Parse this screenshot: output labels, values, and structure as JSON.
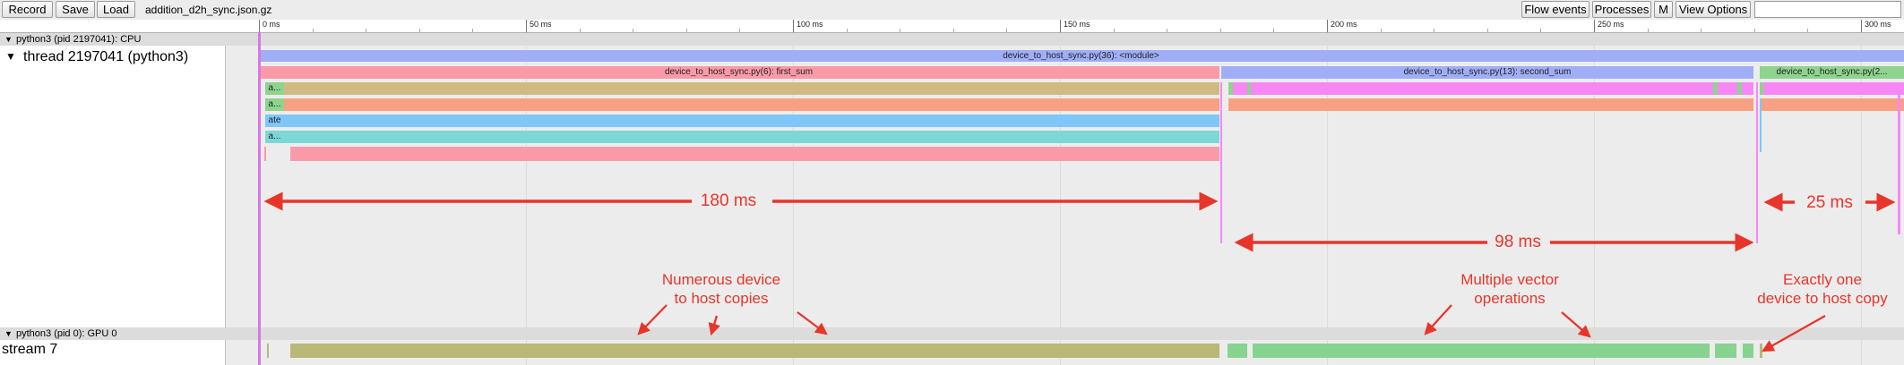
{
  "toolbar": {
    "record_label": "Record",
    "save_label": "Save",
    "load_label": "Load",
    "filename": "addition_d2h_sync.json.gz",
    "flow_events_label": "Flow events",
    "processes_label": "Processes",
    "m_label": "M",
    "view_options_label": "View Options",
    "search_value": ""
  },
  "ruler": {
    "ticks": [
      "0 ms",
      "50 ms",
      "100 ms",
      "150 ms",
      "200 ms",
      "250 ms",
      "300 ms"
    ]
  },
  "cpu_process": {
    "title": "python3 (pid 2197041): CPU",
    "thread_name": "thread 2197041 (python3)"
  },
  "gpu_process": {
    "title": "python3 (pid 0): GPU 0",
    "stream_name": "stream 7"
  },
  "slices": {
    "module": "device_to_host_sync.py(36): <module>",
    "first_sum": "device_to_host_sync.py(6): first_sum",
    "second_sum": "device_to_host_sync.py(13): second_sum",
    "third": "device_to_host_sync.py(2...",
    "stack": [
      "a...",
      "a...",
      "ate",
      "a..."
    ]
  },
  "annotations": {
    "d1": "180 ms",
    "d2": "98 ms",
    "d3": "25 ms",
    "note1": "Numerous device\nto host copies",
    "note2": "Multiple vector\noperations",
    "note3": "Exactly one\ndevice to host copy"
  },
  "colors": {
    "module": "#9faef7",
    "first_sum": "#fa9aa8",
    "olive": "#cfbb82",
    "salmon": "#f7a182",
    "skyblue": "#7fc7f8",
    "teal": "#7dd7d6",
    "magenta": "#f887f6",
    "green": "#8ed38e",
    "gpu_olive": "#b9b877",
    "gpu_green": "#86d48f",
    "annotation": "#e8352a"
  }
}
